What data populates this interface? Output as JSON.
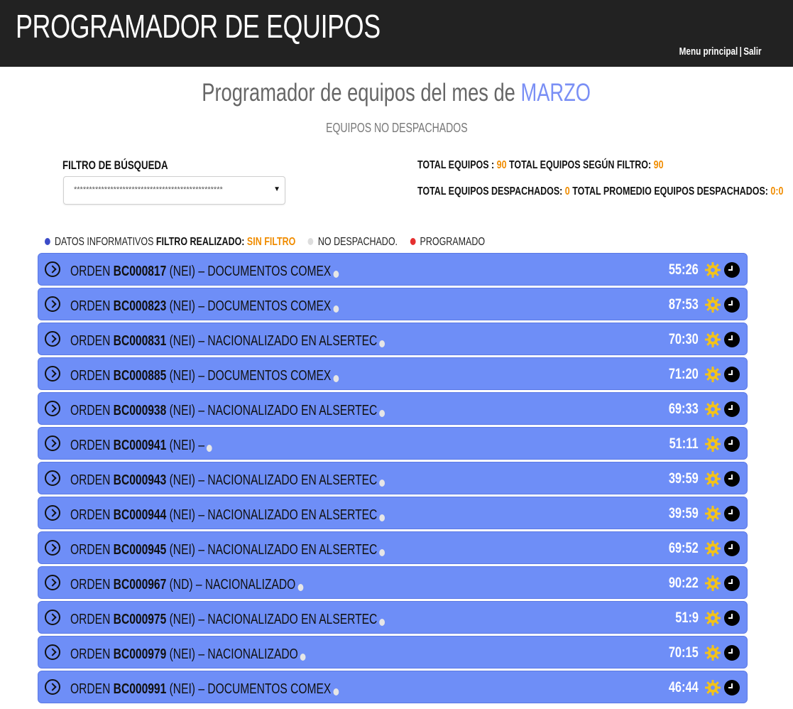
{
  "header": {
    "app_title": "PROGRAMADOR DE EQUIPOS",
    "nav_main": "Menu principal",
    "nav_sep": "|",
    "nav_exit": "Salir"
  },
  "page": {
    "heading_prefix": "Programador de equipos del mes de",
    "month": "MARZO",
    "subheading": "EQUIPOS NO DESPACHADOS"
  },
  "filter": {
    "label": "FILTRO DE BÚSQUEDA",
    "selected": "*************************************************"
  },
  "stats": {
    "total_label": "TOTAL EQUIPOS :",
    "total_value": "90",
    "total_filter_label": "TOTAL EQUIPOS SEGÚN FILTRO:",
    "total_filter_value": "90",
    "dispatched_label": "TOTAL EQUIPOS DESPACHADOS:",
    "dispatched_value": "0",
    "avg_label": "TOTAL PROMEDIO EQUIPOS DESPACHADOS:",
    "avg_value": "0:0"
  },
  "legend": {
    "info_label": "DATOS INFORMATIVOS",
    "filter_label": "FILTRO REALIZADO:",
    "filter_value": "SIN FILTRO",
    "not_dispatched": "NO DESPACHADO.",
    "scheduled": "PROGRAMADO",
    "colors": {
      "info": "#3b4bc8",
      "not_dispatched": "#dddddd",
      "scheduled": "#e53030"
    }
  },
  "orders": [
    {
      "prefix": "ORDEN",
      "code": "BC000817",
      "detail": "(NEI) – DOCUMENTOS COMEX",
      "time": "55:26"
    },
    {
      "prefix": "ORDEN",
      "code": "BC000823",
      "detail": "(NEI) – DOCUMENTOS COMEX",
      "time": "87:53"
    },
    {
      "prefix": "ORDEN",
      "code": "BC000831",
      "detail": "(NEI) – NACIONALIZADO EN ALSERTEC",
      "time": "70:30"
    },
    {
      "prefix": "ORDEN",
      "code": "BC000885",
      "detail": "(NEI) – DOCUMENTOS COMEX",
      "time": "71:20"
    },
    {
      "prefix": "ORDEN",
      "code": "BC000938",
      "detail": "(NEI) – NACIONALIZADO EN ALSERTEC",
      "time": "69:33"
    },
    {
      "prefix": "ORDEN",
      "code": "BC000941",
      "detail": "(NEI) –",
      "time": "51:11"
    },
    {
      "prefix": "ORDEN",
      "code": "BC000943",
      "detail": "(NEI) – NACIONALIZADO EN ALSERTEC",
      "time": "39:59"
    },
    {
      "prefix": "ORDEN",
      "code": "BC000944",
      "detail": "(NEI) – NACIONALIZADO EN ALSERTEC",
      "time": "39:59"
    },
    {
      "prefix": "ORDEN",
      "code": "BC000945",
      "detail": "(NEI) – NACIONALIZADO EN ALSERTEC",
      "time": "69:52"
    },
    {
      "prefix": "ORDEN",
      "code": "BC000967",
      "detail": "(ND) – NACIONALIZADO",
      "time": "90:22"
    },
    {
      "prefix": "ORDEN",
      "code": "BC000975",
      "detail": "(NEI) – NACIONALIZADO EN ALSERTEC",
      "time": "51:9"
    },
    {
      "prefix": "ORDEN",
      "code": "BC000979",
      "detail": "(NEI) – NACIONALIZADO",
      "time": "70:15"
    },
    {
      "prefix": "ORDEN",
      "code": "BC000991",
      "detail": "(NEI) – DOCUMENTOS COMEX",
      "time": "46:44"
    }
  ],
  "icons": {
    "expand": "chevron-circle-right-icon",
    "settings": "gear-icon",
    "schedule": "clock-icon"
  },
  "colors": {
    "row_bg": "#6e8ef7",
    "accent_orange": "#f08c00",
    "header_bg": "#222222",
    "month": "#7a8ff5",
    "gear": "#f2c21b"
  }
}
